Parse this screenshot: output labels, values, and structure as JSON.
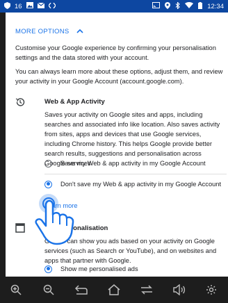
{
  "statusbar": {
    "notif_count": "16",
    "time": "12:34"
  },
  "more_options": {
    "label": "MORE OPTIONS"
  },
  "intro": {
    "p1": "Customise your Google experience by confirming your personalisation settings and the data stored with your account.",
    "p2": "You can always learn more about these options, adjust them, and review your activity in your Google Account (account.google.com)."
  },
  "web_app_activity": {
    "title": "Web & App Activity",
    "description": "Saves your activity on Google sites and apps, including searches and associated info like location. Also saves activity from sites, apps and devices that use Google services, including Chrome history. This helps Google provide better search results, suggestions and personalisation across Google services.",
    "options": [
      {
        "label": "Save my Web & app activity in my Google Account",
        "selected": false
      },
      {
        "label": "Don't save my Web & app activity in my Google Account",
        "selected": true
      }
    ],
    "learn_more": "Learn more"
  },
  "ads_personalisation": {
    "title": "Ads Personalisation",
    "description": "Google can show you ads based on your activity on Google services (such as Search or YouTube), and on websites and apps that partner with Google.",
    "options": [
      {
        "label": "Show me personalised ads",
        "selected": true
      }
    ]
  },
  "colors": {
    "accent": "#1a73e8",
    "statusbar": "#0d47a1",
    "navbar": "#1d1d1d"
  },
  "navbar": {
    "icons": [
      "zoom-in-icon",
      "zoom-out-icon",
      "back-icon",
      "home-icon",
      "recents-icon",
      "volume-icon",
      "settings-icon"
    ]
  }
}
